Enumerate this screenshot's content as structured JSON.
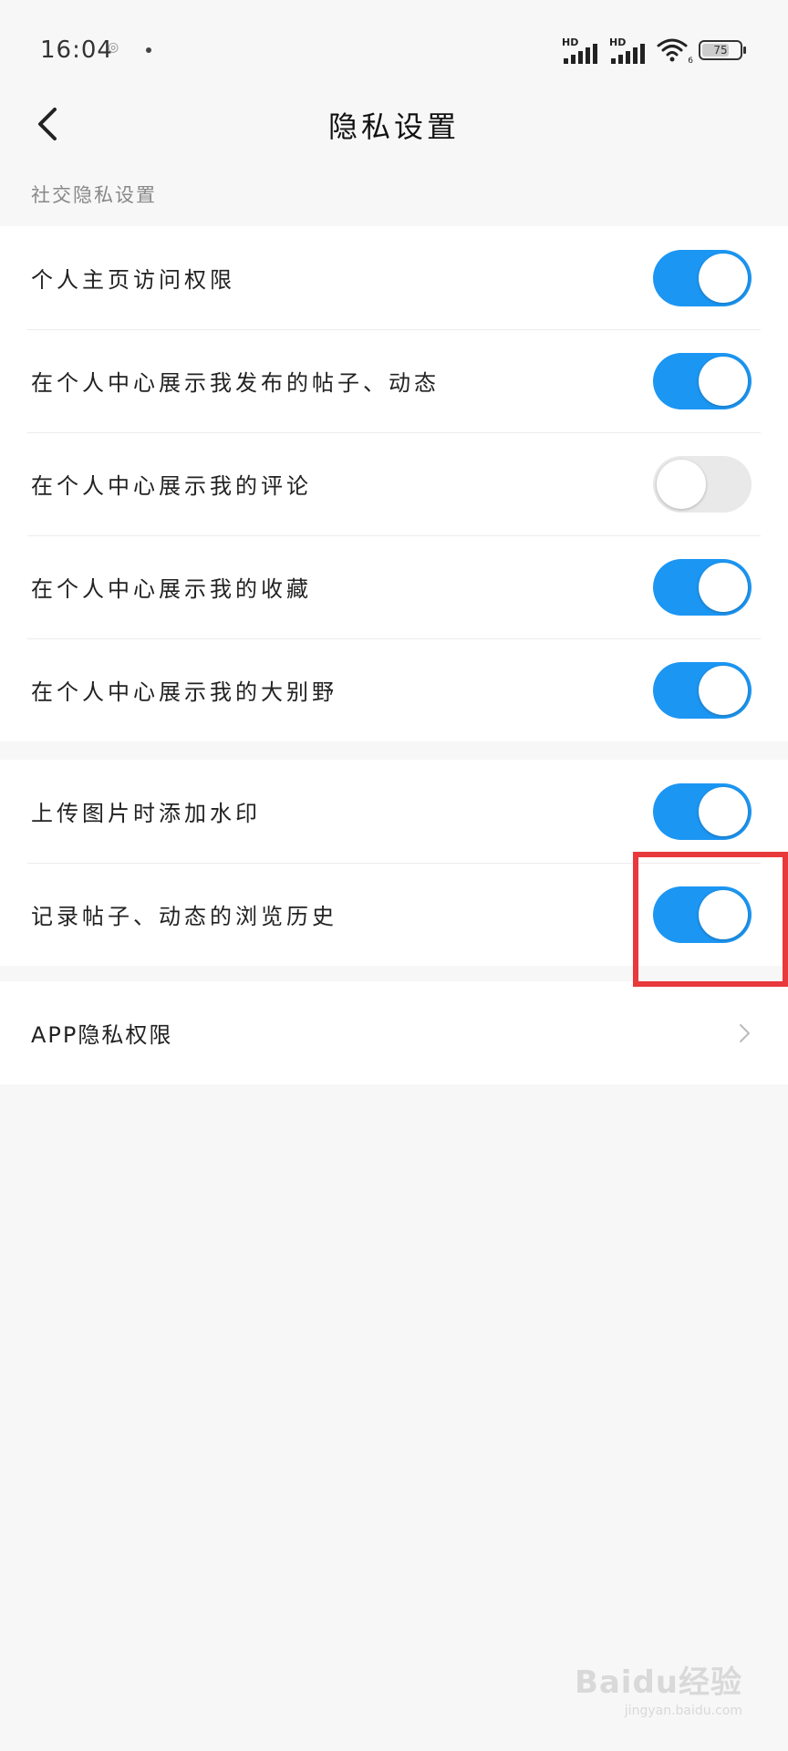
{
  "status_bar": {
    "time": "16:04",
    "battery": "75",
    "battery_level": 0.75,
    "network_label": "HD",
    "wifi_label": "6"
  },
  "header": {
    "title": "隐私设置"
  },
  "section_label": "社交隐私设置",
  "group1": {
    "items": [
      {
        "label": "个人主页访问权限",
        "on": true
      },
      {
        "label": "在个人中心展示我发布的帖子、动态",
        "on": true
      },
      {
        "label": "在个人中心展示我的评论",
        "on": false
      },
      {
        "label": "在个人中心展示我的收藏",
        "on": true
      },
      {
        "label": "在个人中心展示我的大别野",
        "on": true
      }
    ]
  },
  "group2": {
    "items": [
      {
        "label": "上传图片时添加水印",
        "on": true
      },
      {
        "label": "记录帖子、动态的浏览历史",
        "on": true
      }
    ]
  },
  "group3": {
    "label": "APP隐私权限"
  },
  "watermark": {
    "main": "Baidu经验",
    "sub": "jingyan.baidu.com"
  },
  "colors": {
    "toggle_on": "#1c96f3",
    "toggle_off": "#e9e9e9",
    "highlight": "#e8393d"
  }
}
